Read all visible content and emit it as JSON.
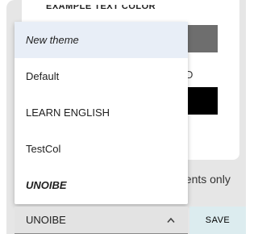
{
  "panel": {
    "cut_title": "EXAMPLE TEXT COLOR",
    "swatch_label": "D",
    "grey_swatch_color": "#6e6e6e",
    "black_swatch_color": "#000000",
    "components_only": "nents only"
  },
  "dropdown": {
    "items": [
      {
        "label": "New theme"
      },
      {
        "label": "Default"
      },
      {
        "label": "LEARN ENGLISH"
      },
      {
        "label": "TestCol"
      },
      {
        "label": "UNOIBE"
      }
    ],
    "selected_value": "UNOIBE"
  },
  "actions": {
    "save_label": "SAVE"
  }
}
